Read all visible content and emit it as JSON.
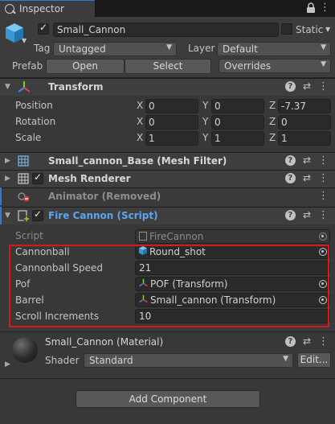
{
  "tab": {
    "title": "Inspector"
  },
  "header": {
    "object_name": "Small_Cannon",
    "static_label": "Static",
    "tag_label": "Tag",
    "tag_value": "Untagged",
    "layer_label": "Layer",
    "layer_value": "Default",
    "prefab_label": "Prefab",
    "open_button": "Open",
    "select_button": "Select",
    "overrides_value": "Overrides"
  },
  "transform": {
    "title": "Transform",
    "rows": [
      {
        "label": "Position",
        "x": "0",
        "y": "0",
        "z": "-7.37"
      },
      {
        "label": "Rotation",
        "x": "0",
        "y": "0",
        "z": "0"
      },
      {
        "label": "Scale",
        "x": "1",
        "y": "1",
        "z": "1"
      }
    ],
    "axis_x": "X",
    "axis_y": "Y",
    "axis_z": "Z"
  },
  "components": {
    "mesh_filter": "Small_cannon_Base (Mesh Filter)",
    "mesh_renderer": "Mesh Renderer",
    "animator": "Animator (Removed)",
    "fire_cannon": "Fire Cannon (Script)"
  },
  "fire_cannon": {
    "script_label": "Script",
    "script_value": "FireCannon",
    "cannonball_label": "Cannonball",
    "cannonball_value": "Round_shot",
    "speed_label": "Cannonball Speed",
    "speed_value": "21",
    "pof_label": "Pof",
    "pof_value": "POF (Transform)",
    "barrel_label": "Barrel",
    "barrel_value": "Small_cannon (Transform)",
    "scroll_label": "Scroll Increments",
    "scroll_value": "10"
  },
  "material": {
    "name": "Small_Cannon (Material)",
    "shader_label": "Shader",
    "shader_value": "Standard",
    "edit_button": "Edit..."
  },
  "add_component_button": "Add Component",
  "colors": {
    "accent": "#2f7ad6",
    "highlight_box": "#d7191d",
    "background": "#383838"
  }
}
